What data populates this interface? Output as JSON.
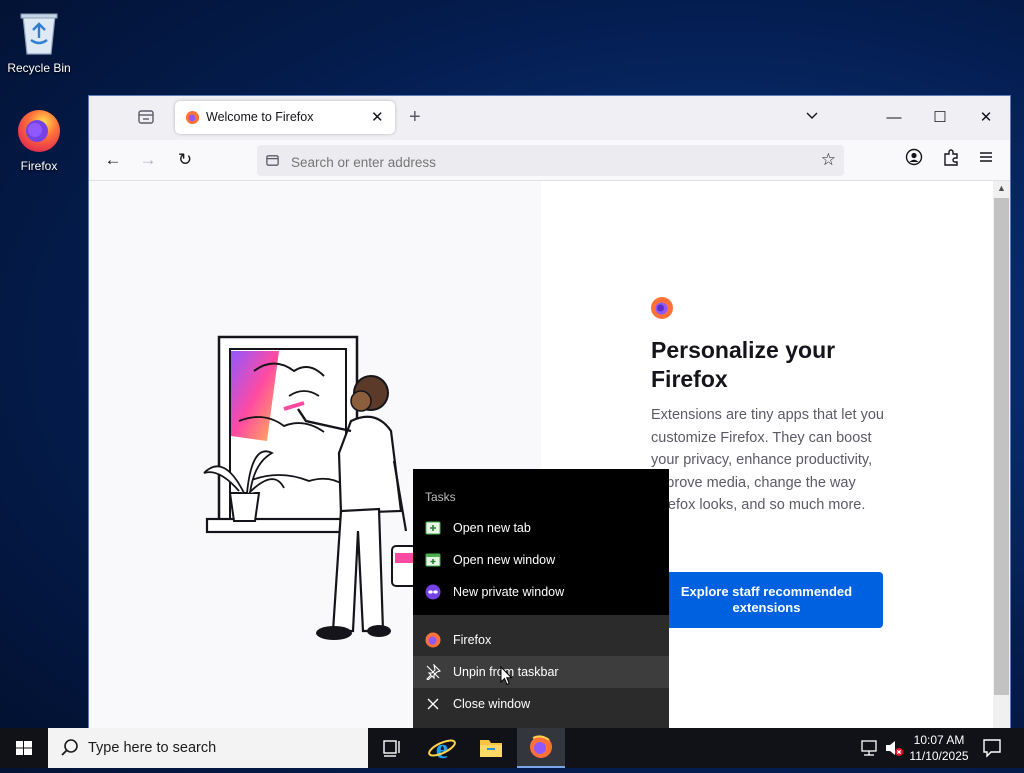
{
  "desktop": {
    "icons": [
      {
        "label": "Recycle Bin",
        "icon": "recycle-bin-icon"
      },
      {
        "label": "Firefox",
        "icon": "firefox-icon"
      }
    ]
  },
  "browser": {
    "tab": {
      "title": "Welcome to Firefox",
      "close_glyph": "✕"
    },
    "new_tab_glyph": "+",
    "window_controls": {
      "minimize": "—",
      "maximize": "☐",
      "close": "✕"
    },
    "nav": {
      "back": "←",
      "forward": "→",
      "reload": "↻"
    },
    "urlbar": {
      "placeholder": "Search or enter address",
      "value": ""
    }
  },
  "page": {
    "heading": "Personalize your Firefox",
    "description": "Extensions are tiny apps that let you customize Firefox. They can boost your privacy, enhance productivity, improve media, change the way Firefox looks, and so much more.",
    "cta_label": "Explore staff recommended extensions"
  },
  "jumplist": {
    "header": "Tasks",
    "tasks": [
      {
        "label": "Open new tab",
        "icon": "new-tab-icon"
      },
      {
        "label": "Open new window",
        "icon": "new-window-icon"
      },
      {
        "label": "New private window",
        "icon": "private-window-icon"
      }
    ],
    "app_items": [
      {
        "label": "Firefox",
        "icon": "firefox-icon"
      },
      {
        "label": "Unpin from taskbar",
        "icon": "unpin-icon"
      },
      {
        "label": "Close window",
        "icon": "close-icon"
      }
    ]
  },
  "taskbar": {
    "search_placeholder": "Type here to search",
    "time": "10:07 AM",
    "date": "11/10/2025",
    "pinned": [
      "task-view-icon",
      "internet-explorer-icon",
      "file-explorer-icon",
      "firefox-icon"
    ]
  },
  "colors": {
    "accent": "#0061e0",
    "taskbar": "#101218",
    "jumplist": "#000000"
  }
}
